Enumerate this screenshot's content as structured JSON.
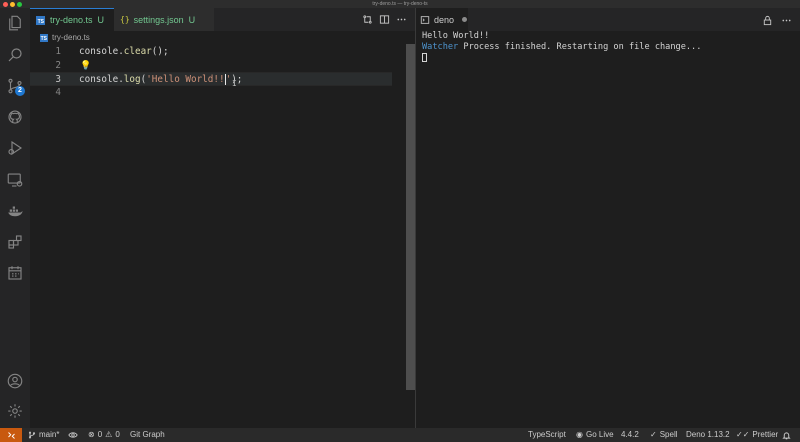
{
  "window": {
    "title": "try-deno.ts — try-deno-ts"
  },
  "editor_tabs": [
    {
      "name": "try-deno.ts",
      "status": "U",
      "icon": "typescript-file-icon",
      "active": true
    },
    {
      "name": "settings.json",
      "status": "U",
      "icon": "json-file-icon",
      "active": false
    }
  ],
  "breadcrumb": {
    "file": "try-deno.ts"
  },
  "editor": {
    "line_numbers": [
      "1",
      "2",
      "3",
      "4"
    ],
    "line1": {
      "obj": "console",
      "dot": ".",
      "fn": "clear",
      "rest": "();"
    },
    "line3": {
      "obj": "console",
      "dot": ".",
      "fn": "log",
      "open": "(",
      "str": "'Hello World!!'",
      "close": ");"
    }
  },
  "activity_bar": {
    "items": [
      "files-icon",
      "search-icon",
      "source-control-icon",
      "github-icon",
      "run-debug-icon",
      "remote-explorer-icon",
      "docker-icon",
      "extensions-icon",
      "calendar-icon"
    ],
    "source_control_badge": "2",
    "bottom": [
      "account-icon",
      "settings-gear-icon"
    ]
  },
  "terminal": {
    "tab_label": "deno",
    "lines": [
      "Hello World!!"
    ],
    "watcher_label": "Watcher",
    "watcher_message": " Process finished. Restarting on file change..."
  },
  "status_bar": {
    "branch": "main*",
    "errors": "0",
    "warnings": "0",
    "git_graph": "Git Graph",
    "language": "TypeScript",
    "go_live": "Go Live",
    "version": "4.4.2",
    "spell": "Spell",
    "deno": "Deno 1.13.2",
    "prettier": "Prettier"
  },
  "colors": {
    "accent": "#2a7ed3",
    "remote": "#c8590f",
    "untracked": "#73c991",
    "string": "#ce9178",
    "function": "#dcdcaa",
    "watcher": "#4e94ce"
  }
}
